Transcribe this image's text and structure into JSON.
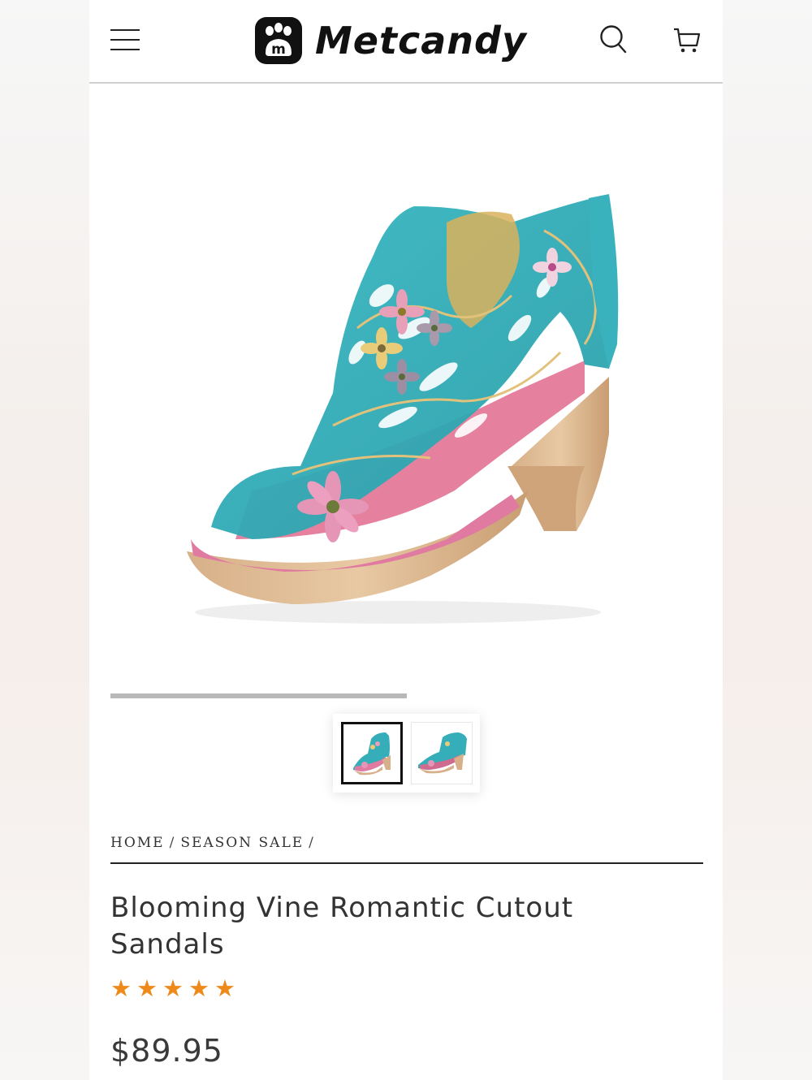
{
  "header": {
    "brand": "Metcandy",
    "menu_icon": "hamburger-menu-icon",
    "search_icon": "search-icon",
    "cart_icon": "cart-icon"
  },
  "product": {
    "image": "teal-floral-cutout-heeled-sandal",
    "gallery_progress": 0.5,
    "thumbnails": [
      {
        "name": "sandal-side-view",
        "active": true
      },
      {
        "name": "sandal-front-view",
        "active": false
      }
    ],
    "breadcrumb": [
      "HOME",
      "SEASON SALE"
    ],
    "breadcrumb_sep": "/",
    "title": "Blooming Vine Romantic Cutout Sandals",
    "rating": 5,
    "rating_max": 5,
    "price": "$89.95",
    "colors": {
      "accent_star": "#ee8a1a",
      "text": "#333333"
    }
  }
}
